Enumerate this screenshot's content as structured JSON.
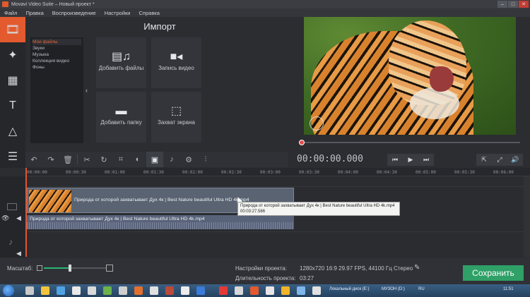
{
  "window": {
    "title": "Movavi Video Suite – Новый проект *"
  },
  "menu": [
    "Файл",
    "Правка",
    "Воспроизведение",
    "Настройки",
    "Справка"
  ],
  "import": {
    "title": "Импорт",
    "categories": [
      "Мои файлы",
      "Звуки",
      "Музыка",
      "Коллекция видео",
      "Фоны"
    ],
    "tiles": {
      "add_files": "Добавить файлы",
      "record_video": "Запись видео",
      "add_folder": "Добавить папку",
      "screen_capture": "Захват экрана"
    }
  },
  "player": {
    "timecode": "00:00:00.000"
  },
  "ruler": [
    "00:00:00",
    "00:00:30",
    "00:01:00",
    "00:01:30",
    "00:02:00",
    "00:02:30",
    "00:03:00",
    "00:03:30",
    "00:04:00",
    "00:04:30",
    "00:05:00",
    "00:05:30",
    "00:06:00"
  ],
  "timeline": {
    "video_clip": "Природа от которой захватывает Дух 4к | Best Nature beautiful Ultra HD 4k.mp4",
    "audio_clip": "Природа от которой захватывает Дух 4к | Best Nature beautiful Ultra HD 4k.mp4",
    "tooltip_name": "Природа от которой захватывает Дух 4к | Best Nature beautiful Ultra HD 4k.mp4",
    "tooltip_duration": "00:03:27.586"
  },
  "bottom": {
    "scale_label": "Масштаб:",
    "settings_label": "Настройки проекта:",
    "settings_value": "1280x720 16:9 29.97 FPS, 44100 Гц Стерео",
    "duration_label": "Длительность проекта:",
    "duration_value": "03:27",
    "save_label": "Сохранить"
  },
  "taskbar": {
    "disk": "Локальный диск (E:)",
    "music": "МУЗОН (D:)",
    "lang": "RU",
    "clock": "11:51"
  }
}
